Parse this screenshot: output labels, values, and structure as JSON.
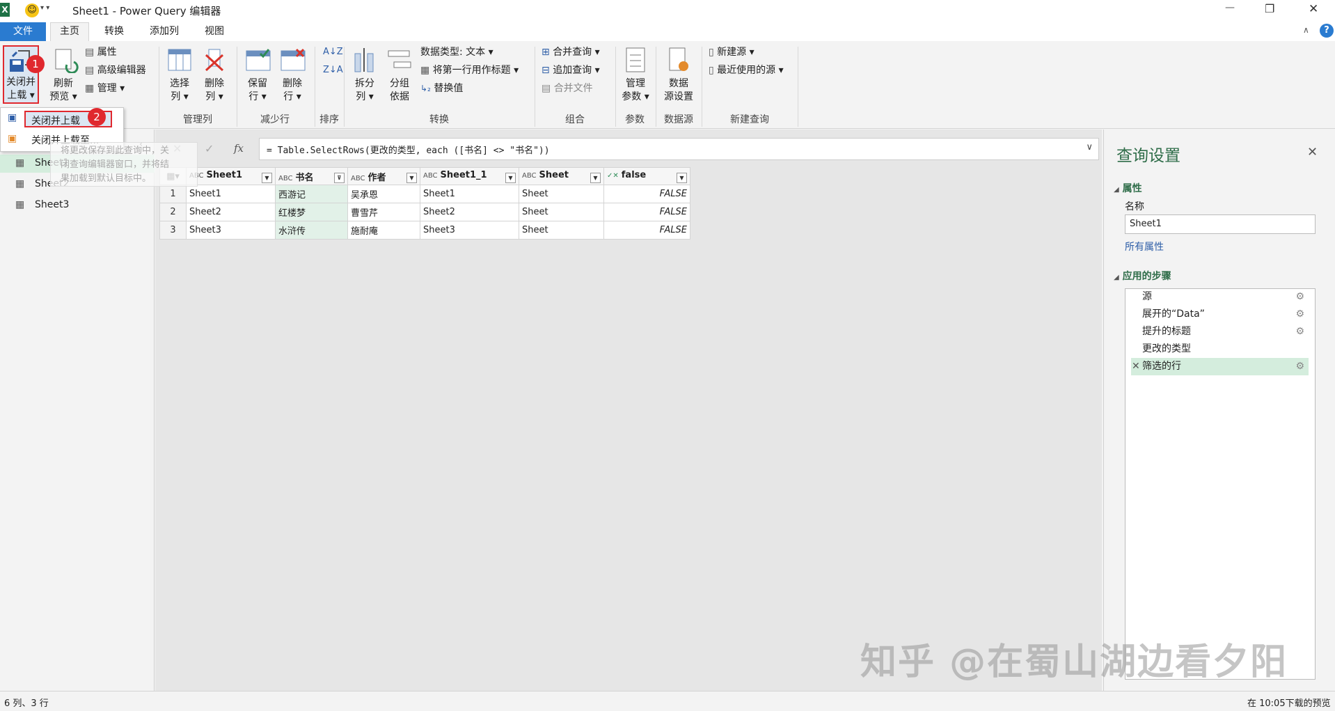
{
  "window": {
    "title": "Sheet1 - Power Query 编辑器",
    "minimize": "—",
    "restore": "❐",
    "close": "✕"
  },
  "tabs": {
    "file": "文件",
    "home": "主页",
    "transform": "转换",
    "add_column": "添加列",
    "view": "视图"
  },
  "ribbon": {
    "close_load_line1": "关闭并",
    "close_load_line2": "上载 ▾",
    "refresh_line1": "刷新",
    "refresh_line2": "预览 ▾",
    "properties": "属性",
    "advanced_editor": "高级编辑器",
    "manage": "管理 ▾",
    "choose_cols_1": "选择",
    "choose_cols_2": "列 ▾",
    "remove_cols_1": "删除",
    "remove_cols_2": "列 ▾",
    "keep_rows_1": "保留",
    "keep_rows_2": "行 ▾",
    "remove_rows_1": "删除",
    "remove_rows_2": "行 ▾",
    "split_1": "拆分",
    "split_2": "列 ▾",
    "group_1": "分组",
    "group_2": "依据",
    "data_type": "数据类型: 文本 ▾",
    "first_row_header": "将第一行用作标题 ▾",
    "replace_values": "替换值",
    "merge_queries": "合并查询 ▾",
    "append_queries": "追加查询 ▾",
    "combine_files": "合并文件",
    "manage_params_1": "管理",
    "manage_params_2": "参数 ▾",
    "ds_settings_1": "数据",
    "ds_settings_2": "源设置",
    "new_source": "新建源 ▾",
    "recent_sources": "最近使用的源 ▾",
    "groups": {
      "manage_cols": "管理列",
      "reduce_rows": "减少行",
      "sort": "排序",
      "transform": "转换",
      "combine": "组合",
      "params": "参数",
      "data_source": "数据源",
      "new_query": "新建查询"
    }
  },
  "dropdown": {
    "close_load": "关闭并上载",
    "close_load_to": "关闭并上载至...",
    "tooltip_1": "将更改保存到此查询中，关",
    "tooltip_2": "闭查询编辑器窗口，并将结",
    "tooltip_3": "果加载到默认目标中。"
  },
  "badges": {
    "one": "1",
    "two": "2"
  },
  "queries": [
    "Sheet1",
    "Sheet2",
    "Sheet3"
  ],
  "formula": {
    "fx": "fx",
    "text": "= Table.SelectRows(更改的类型, each ([书名] <> \"书名\"))"
  },
  "grid": {
    "columns": [
      {
        "type": "ABC",
        "name": "Sheet1"
      },
      {
        "type": "ABC",
        "name": "书名"
      },
      {
        "type": "ABC",
        "name": "作者"
      },
      {
        "type": "ABC",
        "name": "Sheet1_1"
      },
      {
        "type": "ABC",
        "name": "Sheet"
      },
      {
        "type": "✓✕",
        "name": "false"
      }
    ],
    "rows": [
      [
        "1",
        "Sheet1",
        "西游记",
        "吴承恩",
        "Sheet1",
        "Sheet",
        "FALSE"
      ],
      [
        "2",
        "Sheet2",
        "红楼梦",
        "曹雪芹",
        "Sheet2",
        "Sheet",
        "FALSE"
      ],
      [
        "3",
        "Sheet3",
        "水浒传",
        "施耐庵",
        "Sheet3",
        "Sheet",
        "FALSE"
      ]
    ]
  },
  "settings": {
    "title": "查询设置",
    "properties": "属性",
    "name_label": "名称",
    "name_value": "Sheet1",
    "all_properties": "所有属性",
    "applied_steps": "应用的步骤",
    "steps": [
      "源",
      "展开的“Data”",
      "提升的标题",
      "更改的类型",
      "筛选的行"
    ]
  },
  "status": {
    "left": "6 列、3 行",
    "right": "在 10:05下载的预览"
  },
  "watermark": "知乎 @在蜀山湖边看夕阳",
  "colors": {
    "accent": "#2a7bd0",
    "badge": "#e0282e",
    "step_selected": "#d4eddd",
    "heading": "#2f6d49"
  }
}
